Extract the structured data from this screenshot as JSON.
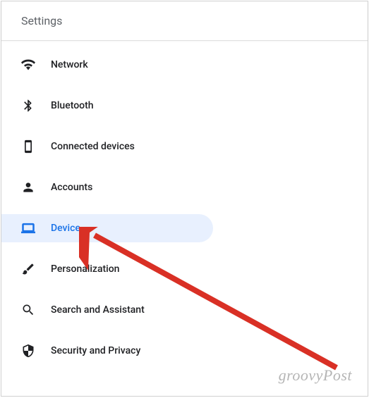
{
  "header": {
    "title": "Settings"
  },
  "menu": {
    "items": [
      {
        "icon": "wifi-icon",
        "label": "Network",
        "selected": false
      },
      {
        "icon": "bluetooth-icon",
        "label": "Bluetooth",
        "selected": false
      },
      {
        "icon": "devices-icon",
        "label": "Connected devices",
        "selected": false
      },
      {
        "icon": "person-icon",
        "label": "Accounts",
        "selected": false
      },
      {
        "icon": "laptop-icon",
        "label": "Device",
        "selected": true
      },
      {
        "icon": "brush-icon",
        "label": "Personalization",
        "selected": false
      },
      {
        "icon": "search-icon",
        "label": "Search and Assistant",
        "selected": false
      },
      {
        "icon": "shield-icon",
        "label": "Security and Privacy",
        "selected": false
      }
    ]
  },
  "annotation": {
    "arrow_target": "Device"
  },
  "watermark": {
    "text": "groovyPost"
  },
  "colors": {
    "accent": "#1a73e8",
    "selected_bg": "#e8f0fe",
    "text": "#202124",
    "muted": "#5f6368"
  }
}
